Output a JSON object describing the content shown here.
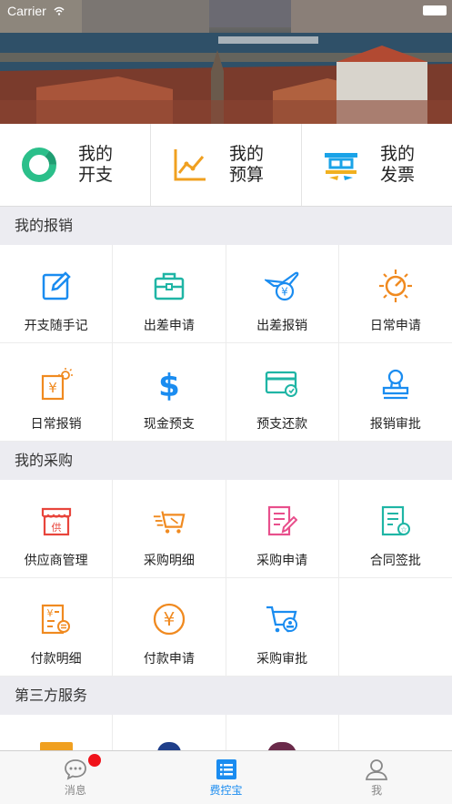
{
  "status_bar": {
    "carrier": "Carrier"
  },
  "summary": [
    {
      "label": "我的开支",
      "line1": "我的",
      "line2": "开支",
      "icon": "donut-chart-icon",
      "color": "#2bbf8a"
    },
    {
      "label": "我的预算",
      "line1": "我的",
      "line2": "预算",
      "icon": "line-chart-icon",
      "color": "#f0a020"
    },
    {
      "label": "我的发票",
      "line1": "我的",
      "line2": "发票",
      "icon": "invoice-icon",
      "color": "#1aa3e8"
    }
  ],
  "sections": {
    "reimburse": {
      "title": "我的报销",
      "items": [
        {
          "label": "开支随手记",
          "icon": "edit-icon",
          "color": "#1a8cf0"
        },
        {
          "label": "出差申请",
          "icon": "suitcase-icon",
          "color": "#1fb5a5"
        },
        {
          "label": "出差报销",
          "icon": "plane-yen-icon",
          "color": "#1a8cf0"
        },
        {
          "label": "日常申请",
          "icon": "sun-clock-icon",
          "color": "#f08a20"
        },
        {
          "label": "日常报销",
          "icon": "yen-doc-sun-icon",
          "color": "#f08a20"
        },
        {
          "label": "现金预支",
          "icon": "dollar-icon",
          "color": "#1a8cf0"
        },
        {
          "label": "预支还款",
          "icon": "card-icon",
          "color": "#1fb5a5"
        },
        {
          "label": "报销审批",
          "icon": "stamp-icon",
          "color": "#1a8cf0"
        }
      ]
    },
    "purchase": {
      "title": "我的采购",
      "items": [
        {
          "label": "供应商管理",
          "icon": "store-icon",
          "color": "#e8453c"
        },
        {
          "label": "采购明细",
          "icon": "cart-fast-icon",
          "color": "#f08a20"
        },
        {
          "label": "采购申请",
          "icon": "doc-pen-icon",
          "color": "#e84f8c"
        },
        {
          "label": "合同签批",
          "icon": "contract-icon",
          "color": "#1fb5a5"
        },
        {
          "label": "付款明细",
          "icon": "yen-list-icon",
          "color": "#f08a20"
        },
        {
          "label": "付款申请",
          "icon": "yen-circle-icon",
          "color": "#f08a20"
        },
        {
          "label": "采购审批",
          "icon": "cart-stamp-icon",
          "color": "#1a8cf0"
        }
      ]
    },
    "third": {
      "title": "第三方服务"
    }
  },
  "tabbar": [
    {
      "label": "消息",
      "icon": "chat-icon",
      "active": false
    },
    {
      "label": "费控宝",
      "icon": "list-icon",
      "active": true
    },
    {
      "label": "我",
      "icon": "person-icon",
      "active": false
    }
  ]
}
